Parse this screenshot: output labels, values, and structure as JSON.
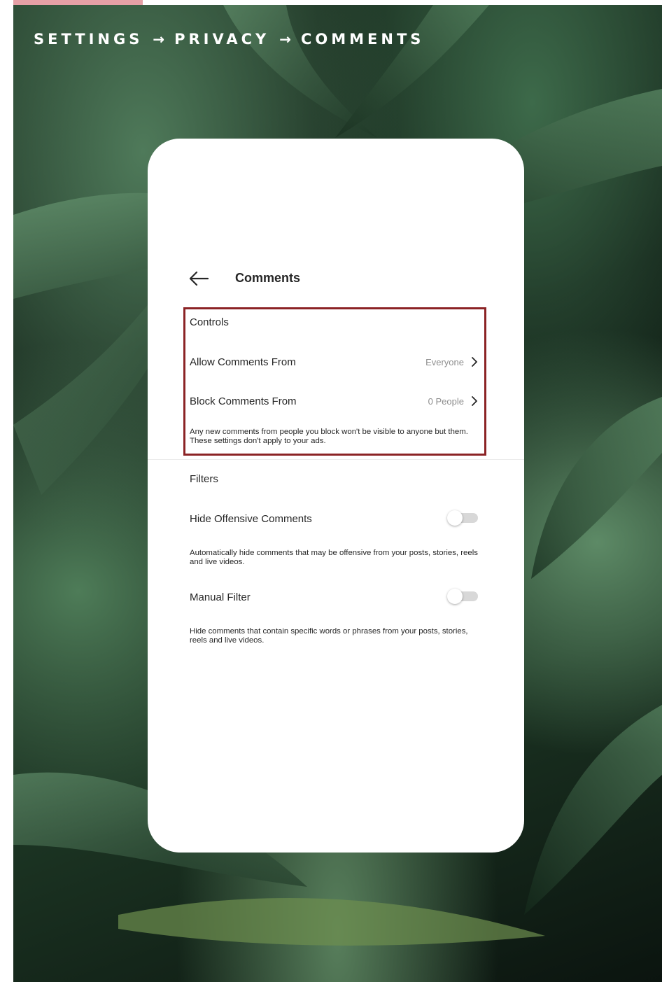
{
  "breadcrumb": {
    "items": [
      "SETTINGS",
      "PRIVACY",
      "COMMENTS"
    ],
    "separator": "→"
  },
  "colors": {
    "highlight_border": "#8b2325",
    "accent_tab": "#e6a0a6"
  },
  "screen": {
    "back_icon": "arrow-left-icon",
    "title": "Comments",
    "controls": {
      "section_label": "Controls",
      "allow": {
        "label": "Allow Comments From",
        "value": "Everyone"
      },
      "block": {
        "label": "Block Comments From",
        "value": "0 People"
      },
      "description": "Any new comments from people you block won't be visible to anyone but them. These settings don't apply to your ads."
    },
    "filters": {
      "section_label": "Filters",
      "hide_offensive": {
        "label": "Hide Offensive Comments",
        "enabled": false,
        "description": "Automatically hide comments that may be offensive from your posts, stories, reels and live videos."
      },
      "manual_filter": {
        "label": "Manual Filter",
        "enabled": false,
        "description": "Hide comments that contain specific words or phrases from your posts, stories, reels and live videos."
      }
    }
  }
}
